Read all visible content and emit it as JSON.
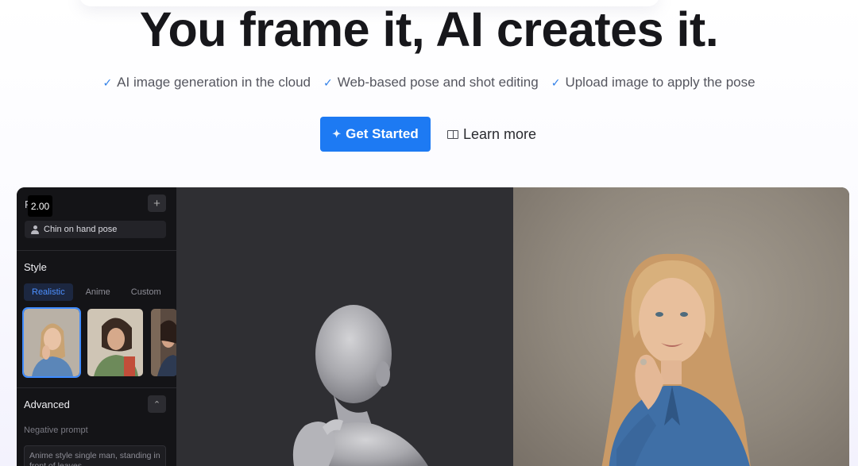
{
  "hero": {
    "title": "You frame it, AI creates it.",
    "features": [
      "AI image generation in the cloud",
      "Web-based pose and shot editing",
      "Upload image to apply the pose"
    ],
    "primary_cta": "Get Started",
    "secondary_cta": "Learn more"
  },
  "icons": {
    "feature_check": "✓",
    "cta_sparkle": "✦",
    "add": "+",
    "collapse": "⌃"
  },
  "app": {
    "zoom_level": "2.00",
    "sidebar_letter": "F",
    "pose_name": "Chin on hand pose",
    "style_section_title": "Style",
    "style_tabs": [
      "Realistic",
      "Anime",
      "Custom"
    ],
    "active_style_tab": "Realistic",
    "advanced_section_title": "Advanced",
    "negative_prompt_label": "Negative prompt",
    "negative_prompt_value": "Anime style single man, standing in front of leaves"
  },
  "colors": {
    "accent": "#1d7af3",
    "check": "#2f7fe8",
    "app_sidebar": "#141417",
    "app_canvas": "#2f2f33"
  }
}
